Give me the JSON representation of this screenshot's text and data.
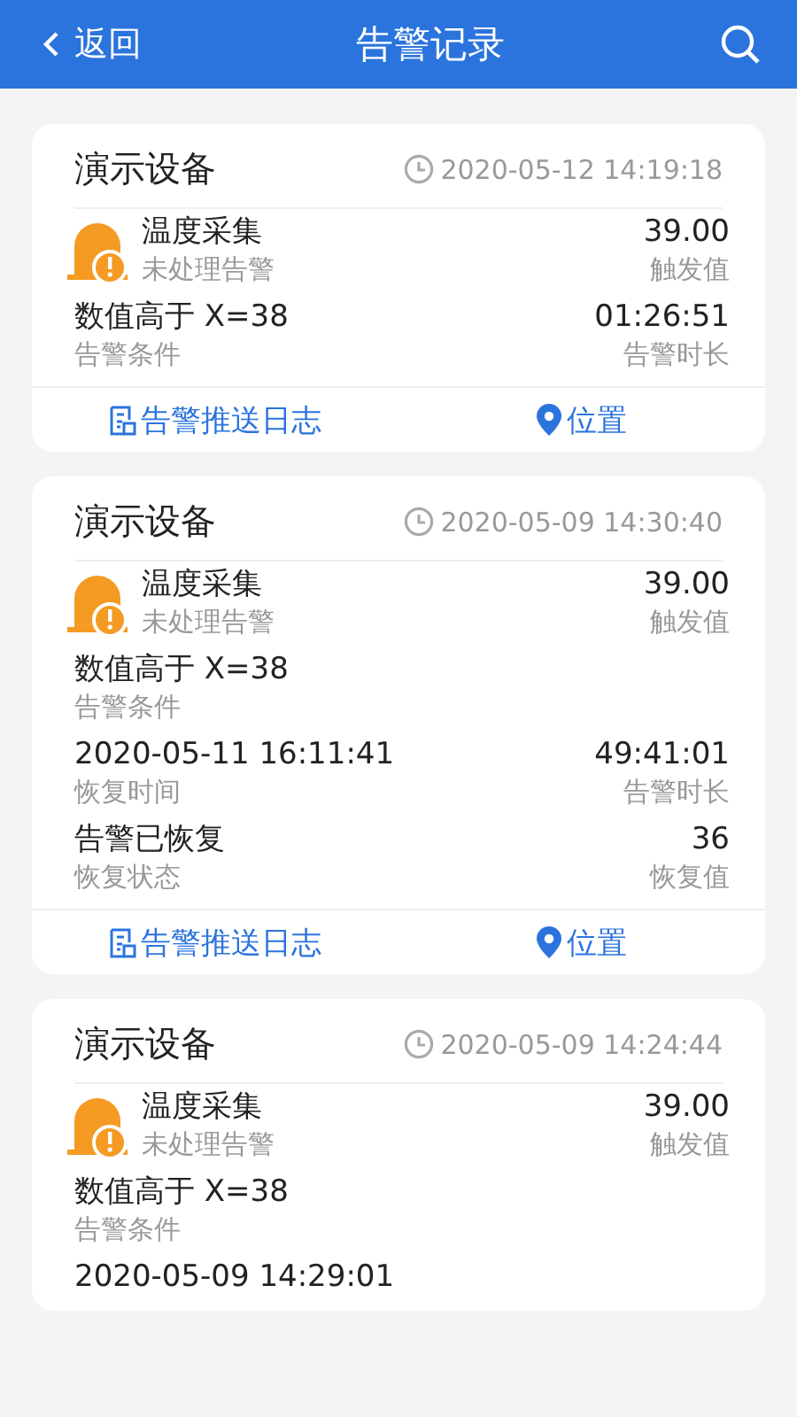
{
  "header": {
    "back": "返回",
    "title": "告警记录"
  },
  "records": [
    {
      "device": "演示设备",
      "time": "2020-05-12 14:19:18",
      "alarm": {
        "name": "温度采集",
        "status": "未处理告警",
        "value": "39.00",
        "value_label": "触发值"
      },
      "rows": [
        {
          "left": {
            "value": "数值高于 X=38",
            "label": "告警条件"
          },
          "right": {
            "value": "01:26:51",
            "label": "告警时长"
          }
        }
      ],
      "actions": [
        {
          "kind": "log",
          "label": "告警推送日志"
        },
        {
          "kind": "location",
          "label": "位置"
        }
      ]
    },
    {
      "device": "演示设备",
      "time": "2020-05-09 14:30:40",
      "alarm": {
        "name": "温度采集",
        "status": "未处理告警",
        "value": "39.00",
        "value_label": "触发值"
      },
      "rows": [
        {
          "left": {
            "value": "数值高于 X=38",
            "label": "告警条件"
          }
        },
        {
          "left": {
            "value": "2020-05-11 16:11:41",
            "label": "恢复时间"
          },
          "right": {
            "value": "49:41:01",
            "label": "告警时长"
          }
        },
        {
          "left": {
            "value": "告警已恢复",
            "label": "恢复状态"
          },
          "right": {
            "value": "36",
            "label": "恢复值"
          }
        }
      ],
      "actions": [
        {
          "kind": "log",
          "label": "告警推送日志"
        },
        {
          "kind": "location",
          "label": "位置"
        }
      ]
    },
    {
      "device": "演示设备",
      "time": "2020-05-09 14:24:44",
      "alarm": {
        "name": "温度采集",
        "status": "未处理告警",
        "value": "39.00",
        "value_label": "触发值"
      },
      "rows": [
        {
          "left": {
            "value": "数值高于 X=38",
            "label": "告警条件"
          }
        },
        {
          "left": {
            "value": "2020-05-09 14:29:01"
          }
        }
      ]
    }
  ]
}
